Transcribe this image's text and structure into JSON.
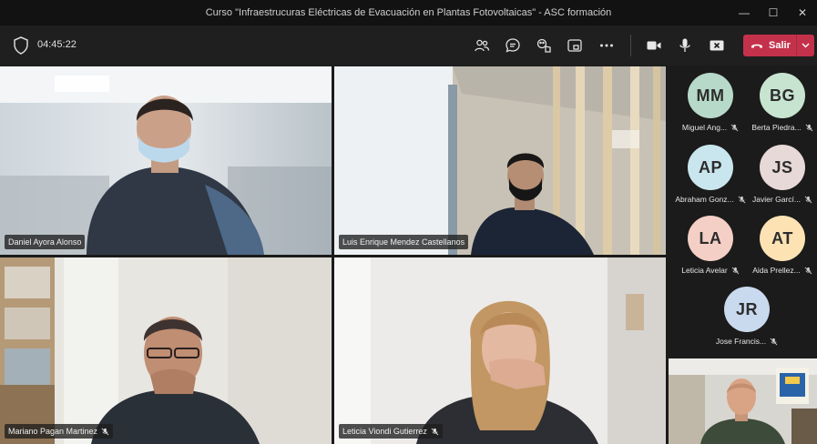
{
  "window": {
    "title": "Curso \"Infraestrucuras Eléctricas de Evacuación en Plantas Fotovoltaicas\" - ASC formación",
    "minimize": "—",
    "maximize": "☐",
    "close": "✕"
  },
  "toolbar": {
    "timer": "04:45:22",
    "leave_label": "Salir"
  },
  "tiles": [
    {
      "name": "Daniel Ayora Alonso",
      "muted": false
    },
    {
      "name": "Luis Enrique Mendez Castellanos",
      "muted": false
    },
    {
      "name": "Mariano Pagan Martinez",
      "muted": true
    },
    {
      "name": "Leticia Viondi Gutierrez",
      "muted": true
    }
  ],
  "participants": [
    {
      "initials": "MM",
      "name": "Miguel Ang...",
      "color": "#b7d9c9"
    },
    {
      "initials": "BG",
      "name": "Berta Piedra...",
      "color": "#c7e4d1"
    },
    {
      "initials": "AP",
      "name": "Abraham Gonz...",
      "color": "#c9e6ee"
    },
    {
      "initials": "JS",
      "name": "Javier Garcí...",
      "color": "#e7d9d7"
    },
    {
      "initials": "LA",
      "name": "Leticia Avelar",
      "color": "#f4cfc5"
    },
    {
      "initials": "AT",
      "name": "Aida Prellez...",
      "color": "#fde3b4"
    },
    {
      "initials": "JR",
      "name": "Jose Francis...",
      "color": "#c9d9ee"
    }
  ],
  "colors": {
    "leave": "#c4314b",
    "avatar_text": "#2d2d2d"
  }
}
